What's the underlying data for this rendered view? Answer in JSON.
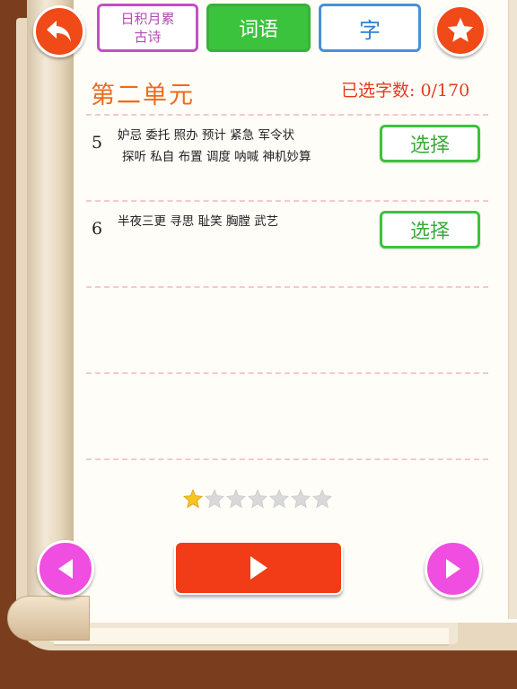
{
  "top_bar": {
    "tab_poem_line1": "日积月累",
    "tab_poem_line2": "古诗",
    "tab_words": "词语",
    "tab_char": "字"
  },
  "unit": {
    "title": "第二单元",
    "count_label": "已选字数: 0/170"
  },
  "rows": [
    {
      "number": "5",
      "line1": "妒忌  委托  照办  预计  紧急  军令状",
      "line2": "探听  私自  布置  调度  呐喊  神机妙算",
      "button_label": "选择"
    },
    {
      "number": "6",
      "line1": "半夜三更  寻思  耻笑  胸膛  武艺",
      "line2": "",
      "button_label": "选择"
    }
  ],
  "rating": {
    "filled": 1,
    "total": 7
  },
  "colors": {
    "accent_orange": "#ef4a18",
    "green": "#3cc33e",
    "pink": "#f04ee0",
    "blue": "#4a8fd8",
    "purple": "#c44fc4"
  },
  "icons": {
    "back": "back-arrow-icon",
    "favorite": "star-icon",
    "prev": "triangle-left-icon",
    "next": "triangle-right-icon",
    "play": "play-icon"
  }
}
